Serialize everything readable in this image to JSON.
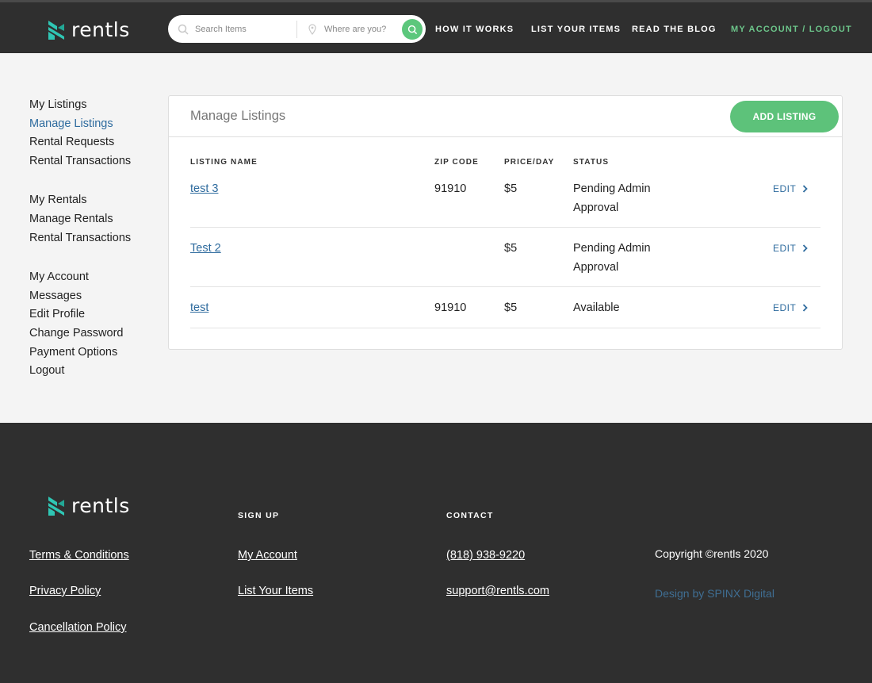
{
  "brand": {
    "name": "rentls",
    "accent": "#5dc27a",
    "link_color": "#2e6b9e"
  },
  "header": {
    "search_placeholder": "Search Items",
    "location_placeholder": "Where are you?",
    "nav": [
      "How it works",
      "List your items",
      "Read the blog",
      "My account / Logout"
    ]
  },
  "sidebar": {
    "groups": [
      {
        "items": [
          "My Listings",
          "Manage Listings",
          "Rental Requests",
          "Rental Transactions"
        ]
      },
      {
        "items": [
          "My Rentals",
          "Manage Rentals",
          "Rental Transactions"
        ]
      },
      {
        "items": [
          "My Account",
          "Messages",
          "Edit Profile",
          "Change Password",
          "Payment Options",
          "Logout"
        ]
      }
    ],
    "active": "Manage Listings"
  },
  "panel": {
    "title": "Manage Listings",
    "add_button": "ADD LISTING",
    "columns": [
      "Listing Name",
      "Zip Code",
      "Price/Day",
      "Status"
    ],
    "rows": [
      {
        "name": "test 3",
        "zip": "91910",
        "price": "$5",
        "status_line1": "Pending Admin",
        "status_line2": "Approval",
        "action": "EDIT"
      },
      {
        "name": "Test 2",
        "zip": "",
        "price": "$5",
        "status_line1": "Pending Admin",
        "status_line2": "Approval",
        "action": "EDIT"
      },
      {
        "name": "test",
        "zip": "91910",
        "price": "$5",
        "status_line1": "Available",
        "status_line2": "",
        "action": "EDIT"
      }
    ]
  },
  "footer": {
    "col1_links": [
      "Terms & Conditions",
      "Privacy Policy",
      "Cancellation Policy"
    ],
    "signup_heading": "Sign up",
    "signup_links": [
      "My Account",
      "List Your Items"
    ],
    "contact_heading": "Contact",
    "phone": "(818) 938-9220",
    "email": "support@rentls.com",
    "copyright": "Copyright ©rentls 2020",
    "design_credit": "Design by SPINX Digital"
  }
}
